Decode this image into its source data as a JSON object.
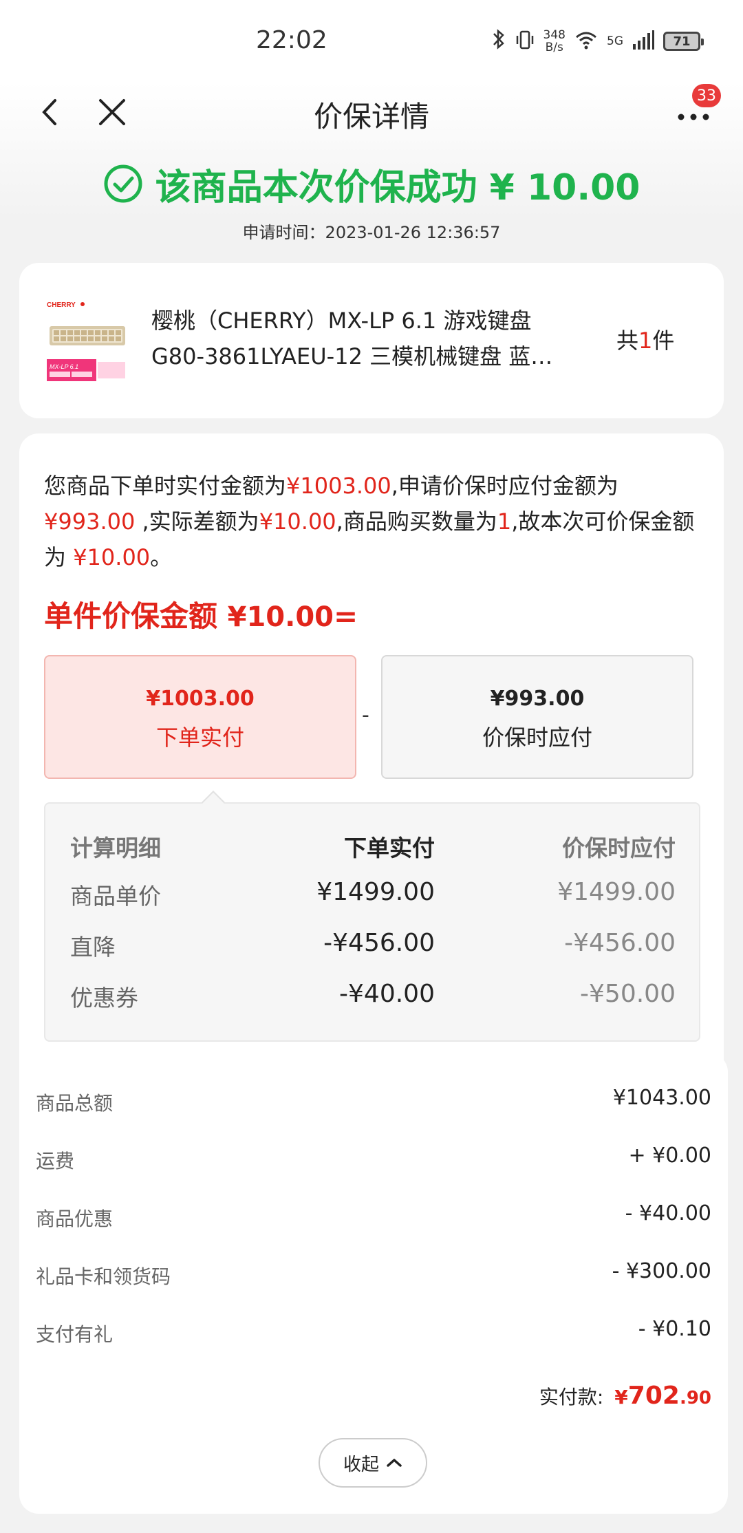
{
  "status_bar": {
    "time": "22:02",
    "net_speed_value": "348",
    "net_speed_unit": "B/s",
    "network": "5G",
    "battery": "71",
    "icons": [
      "bluetooth-icon",
      "vibrate-icon",
      "wifi-icon",
      "signal-icon",
      "battery-icon"
    ]
  },
  "nav": {
    "title": "价保详情",
    "badge": "33",
    "icons": [
      "back-icon",
      "close-icon",
      "more-icon"
    ]
  },
  "success": {
    "text": "该商品本次价保成功 ¥ 10.00",
    "apply_time": "申请时间：2023-01-26 12:36:57",
    "color": "#1fb34d"
  },
  "product": {
    "title_line1": "樱桃（CHERRY）MX-LP 6.1 游戏键盘",
    "title_line2": "G80-3861LYAEU-12 三模机械键盘 蓝…",
    "qty_prefix": "共",
    "qty_num": "1",
    "qty_suffix": "件",
    "thumb_brand": "CHERRY",
    "thumb_model": "MX-LP 6.1"
  },
  "explain": {
    "p1": "您商品下单时实付金额为",
    "paid": "¥1003.00",
    "p2": ",申请价保时应付金额为",
    "apply_pay": "¥993.00",
    "p3": " ,实际差额为",
    "diff": "¥10.00",
    "p4": ",商品购买数量为",
    "qty": "1",
    "p5": ",故本次可价保金额为 ",
    "refund": "¥10.00",
    "p6": "。"
  },
  "unit_amount": {
    "label": "单件价保金额 ",
    "value": "¥10.00",
    "equals": "="
  },
  "boxes": {
    "paid_amount": "¥1003.00",
    "paid_label": "下单实付",
    "minus": "-",
    "apply_amount": "¥993.00",
    "apply_label": "价保时应付"
  },
  "calc": {
    "header": [
      "计算明细",
      "下单实付",
      "价保时应付"
    ],
    "rows": [
      [
        "商品单价",
        "¥1499.00",
        "¥1499.00"
      ],
      [
        "直降",
        "-¥456.00",
        "-¥456.00"
      ],
      [
        "优惠券",
        "-¥40.00",
        "-¥50.00"
      ]
    ]
  },
  "summary": {
    "rows": [
      {
        "label": "商品总额",
        "value": "¥1043.00"
      },
      {
        "label": "运费",
        "value": "+ ¥0.00"
      },
      {
        "label": "商品优惠",
        "value": "- ¥40.00"
      },
      {
        "label": "礼品卡和领货码",
        "value": "- ¥300.00"
      },
      {
        "label": "支付有礼",
        "value": "- ¥0.10"
      }
    ],
    "total_label": "实付款:",
    "total_symbol": "¥",
    "total_int": "702",
    "total_dec": ".90",
    "collapse_label": "收起"
  },
  "colors": {
    "accent_red": "#e1251b",
    "success_green": "#1fb34d"
  }
}
